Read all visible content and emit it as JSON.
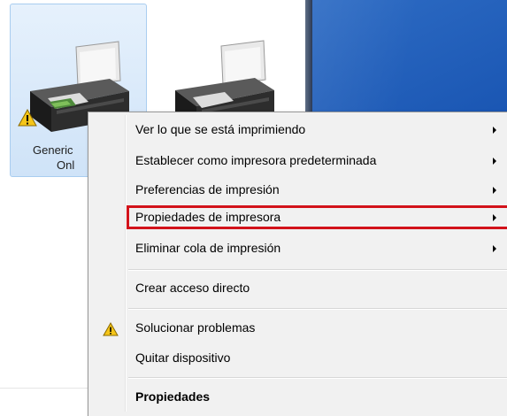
{
  "devices": {
    "selected": {
      "label_line1": "Generic",
      "label_line2": "Onl",
      "icon": "printer-icon",
      "badge": "warning-icon"
    },
    "other": {
      "icon": "printer-icon"
    }
  },
  "context_menu": {
    "items": [
      {
        "label": "Ver lo que se está imprimiendo",
        "has_submenu": true
      },
      {
        "label": "Establecer como impresora predeterminada",
        "has_submenu": true
      },
      {
        "label": "Preferencias de impresión",
        "has_submenu": true
      },
      {
        "label": "Propiedades de impresora",
        "has_submenu": true,
        "highlighted": true
      },
      {
        "label": "Eliminar cola de impresión",
        "has_submenu": true
      },
      {
        "label": "Crear acceso directo",
        "has_submenu": false
      },
      {
        "label": "Solucionar problemas",
        "has_submenu": false,
        "icon": "warning-icon"
      },
      {
        "label": "Quitar dispositivo",
        "has_submenu": false
      },
      {
        "label": "Propiedades",
        "has_submenu": false,
        "bold": true
      }
    ]
  },
  "colors": {
    "highlight_border": "#d2121a",
    "menu_background": "#f1f1f1",
    "selection_background": "#cfe3f8",
    "desktop_blue": "#1a56b3",
    "warning_yellow": "#f5c518"
  }
}
